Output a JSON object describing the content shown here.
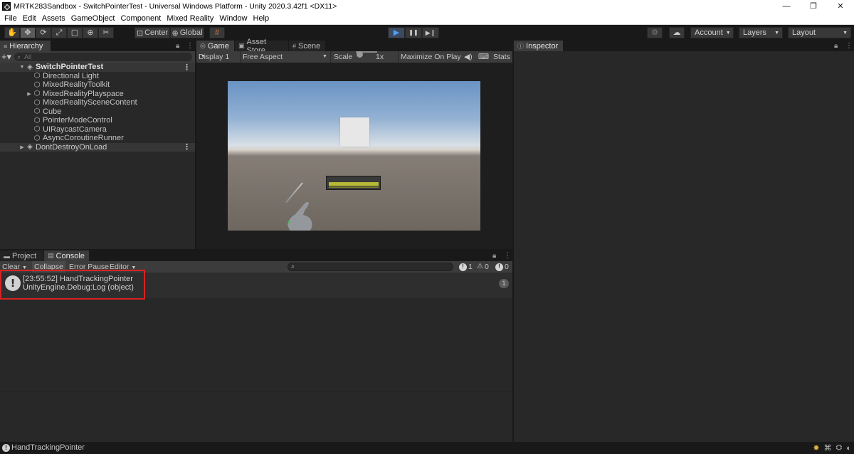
{
  "window": {
    "title": "MRTK283Sandbox - SwitchPointerTest - Universal Windows Platform - Unity 2020.3.42f1 <DX11>",
    "controls": {
      "minimize": "—",
      "maximize": "❐",
      "close": "✕"
    }
  },
  "menu": [
    "File",
    "Edit",
    "Assets",
    "GameObject",
    "Component",
    "Mixed Reality",
    "Window",
    "Help"
  ],
  "toolbar": {
    "tools": [
      {
        "name": "hand-tool",
        "glyph": "✋"
      },
      {
        "name": "move-tool",
        "glyph": "✥"
      },
      {
        "name": "rotate-tool",
        "glyph": "⟳"
      },
      {
        "name": "scale-tool",
        "glyph": "⤢"
      },
      {
        "name": "rect-tool",
        "glyph": "▢"
      },
      {
        "name": "transform-tool",
        "glyph": "⊕"
      },
      {
        "name": "custom-tool",
        "glyph": "✂"
      }
    ],
    "pivot_label": "Center",
    "space_label": "Global",
    "play": "▶",
    "pause": "❚❚",
    "step": "▶❙",
    "account_label": "Account",
    "layers_label": "Layers",
    "layout_label": "Layout"
  },
  "hierarchy": {
    "tab_label": "Hierarchy",
    "search_placeholder": "All",
    "items": [
      {
        "label": "SwitchPointerTest",
        "indent": 0,
        "type": "scene",
        "expanded": true
      },
      {
        "label": "Directional Light",
        "indent": 2,
        "type": "object"
      },
      {
        "label": "MixedRealityToolkit",
        "indent": 2,
        "type": "object"
      },
      {
        "label": "MixedRealityPlayspace",
        "indent": 2,
        "type": "object",
        "collapsed": true
      },
      {
        "label": "MixedRealitySceneContent",
        "indent": 2,
        "type": "object"
      },
      {
        "label": "Cube",
        "indent": 2,
        "type": "object"
      },
      {
        "label": "PointerModeControl",
        "indent": 2,
        "type": "object"
      },
      {
        "label": "UIRaycastCamera",
        "indent": 2,
        "type": "object"
      },
      {
        "label": "AsyncCoroutineRunner",
        "indent": 2,
        "type": "object"
      },
      {
        "label": "DontDestroyOnLoad",
        "indent": 0,
        "type": "scene",
        "collapsed": true
      }
    ]
  },
  "game": {
    "tabs": [
      "Game",
      "Asset Store",
      "Scene"
    ],
    "display": "Display 1",
    "aspect": "Free Aspect",
    "scale_label": "Scale",
    "scale_value": "1x",
    "maximize_label": "Maximize On Play",
    "stats_label": "Stats"
  },
  "inspector": {
    "tab_label": "Inspector"
  },
  "console": {
    "tabs": [
      "Project",
      "Console"
    ],
    "clear": "Clear",
    "collapse": "Collapse",
    "error_pause": "Error Pause",
    "editor": "Editor",
    "counts": {
      "info": "1",
      "warn": "0",
      "error": "0"
    },
    "log": {
      "line1": "[23:55:52] HandTrackingPointer",
      "line2": "UnityEngine.Debug:Log (object)",
      "count": "1"
    }
  },
  "status": {
    "text": "HandTrackingPointer"
  },
  "colors": {
    "accent_play": "#4f9ef2",
    "highlight": "#d92222"
  }
}
